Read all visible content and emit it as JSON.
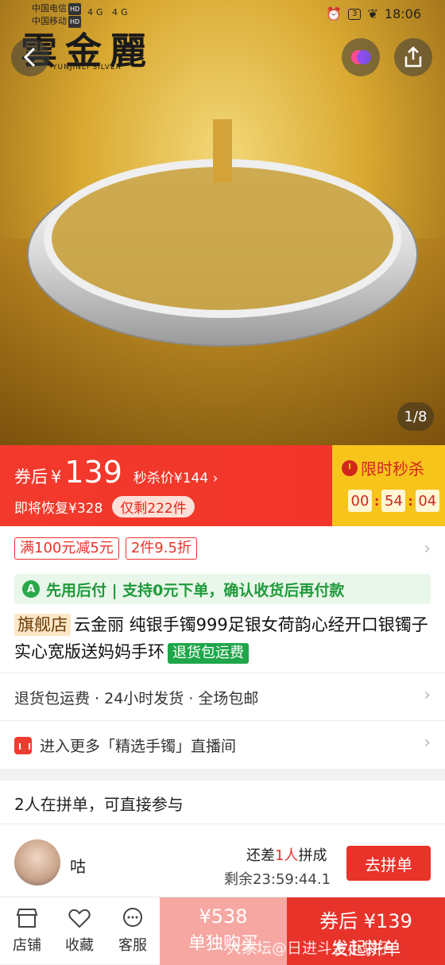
{
  "status_bar": {
    "carrier1": "中国电信",
    "carrier2": "中国移动",
    "hd": "HD",
    "signal": "4G 4G",
    "battery": "3",
    "time": "18:06"
  },
  "hero": {
    "brand_logo": "雲金麗",
    "brand_sub": "YUNJINLI SILVER",
    "page_indicator": "1/8"
  },
  "price": {
    "coupon_label": "券后",
    "currency": "¥",
    "price": "139",
    "seckill": "秒杀价¥144",
    "restore": "即将恢复¥328",
    "remaining": "仅剩222件",
    "limited_label": "限时秒杀",
    "countdown": [
      "00",
      "54",
      "04"
    ]
  },
  "promo": {
    "tags": [
      "满100元减5元",
      "2件9.5折"
    ]
  },
  "paylater": {
    "icon_letter": "A",
    "text": "先用后付 | 支持0元下单，确认收货后再付款"
  },
  "product": {
    "flag": "旗舰店",
    "title": "云金丽 纯银手镯999足银女荷韵心经开口银镯子实心宽版送妈妈手环",
    "return_tag": "退货包运费"
  },
  "services": "退货包运费 · 24小时发货 · 全场包邮",
  "live": "进入更多「精选手镯」直播间",
  "group": {
    "title": "2人在拼单，可直接参与",
    "user": "咕",
    "need_prefix": "还差",
    "need_count": "1人",
    "need_suffix": "拼成",
    "time_left": "剩余23:59:44.1",
    "join": "去拼单"
  },
  "bottom": {
    "store": "店铺",
    "fav": "收藏",
    "cs": "客服",
    "solo_price": "¥538",
    "solo_label": "单独购买",
    "group_price": "券后 ¥139",
    "group_label": "发起拼单",
    "watermark": "大家坛@日进斗金小袋子"
  }
}
